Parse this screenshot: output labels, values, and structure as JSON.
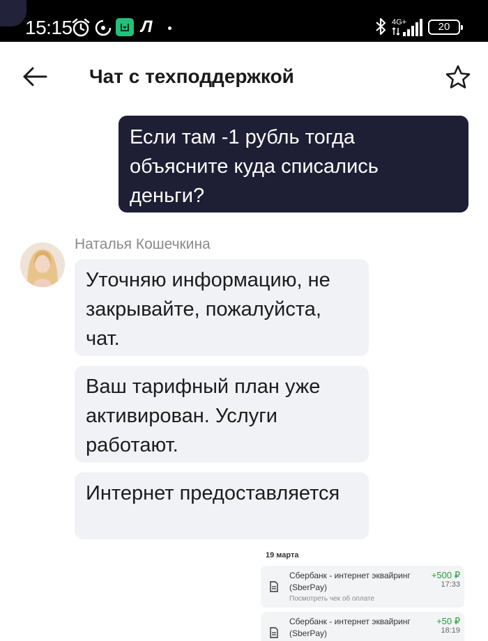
{
  "status_bar": {
    "time": "15:15",
    "network": "4G+",
    "battery": "20",
    "icons": [
      "alarm-icon",
      "music-disc-icon",
      "green-app-icon",
      "l-app-icon",
      "dot-icon",
      "bluetooth-icon",
      "signal-icon",
      "battery-icon"
    ]
  },
  "header": {
    "title": "Чат с техподдержкой",
    "back_icon": "arrow-left-icon",
    "favorite_icon": "star-icon"
  },
  "chat": {
    "outgoing": [
      {
        "text": "Если там -1 рубль тогда объясните куда списались деньги?"
      }
    ],
    "agent": {
      "name": "Наталья Кошечкина",
      "messages": [
        {
          "text": "Уточняю информацию, не закрывайте, пожалуйста, чат."
        },
        {
          "text": "Ваш тарифный план уже активирован. Услуги работают."
        },
        {
          "text": "Интернет предоставляется"
        }
      ]
    }
  },
  "attachment": {
    "date": "19 марта",
    "transactions": [
      {
        "name": "Сбербанк - интернет эквайринг",
        "method": "(SberPay)",
        "amount": "+500 ₽",
        "time": "17:33",
        "link": "Посмотреть чек об оплате"
      },
      {
        "name": "Сбербанк - интернет эквайринг",
        "method": "(SberPay)",
        "amount": "+50 ₽",
        "time": "18:19"
      }
    ]
  },
  "colors": {
    "outgoing_bubble": "#1e1f35",
    "incoming_bubble": "#f1f2f5",
    "amount_positive": "#21a038"
  }
}
